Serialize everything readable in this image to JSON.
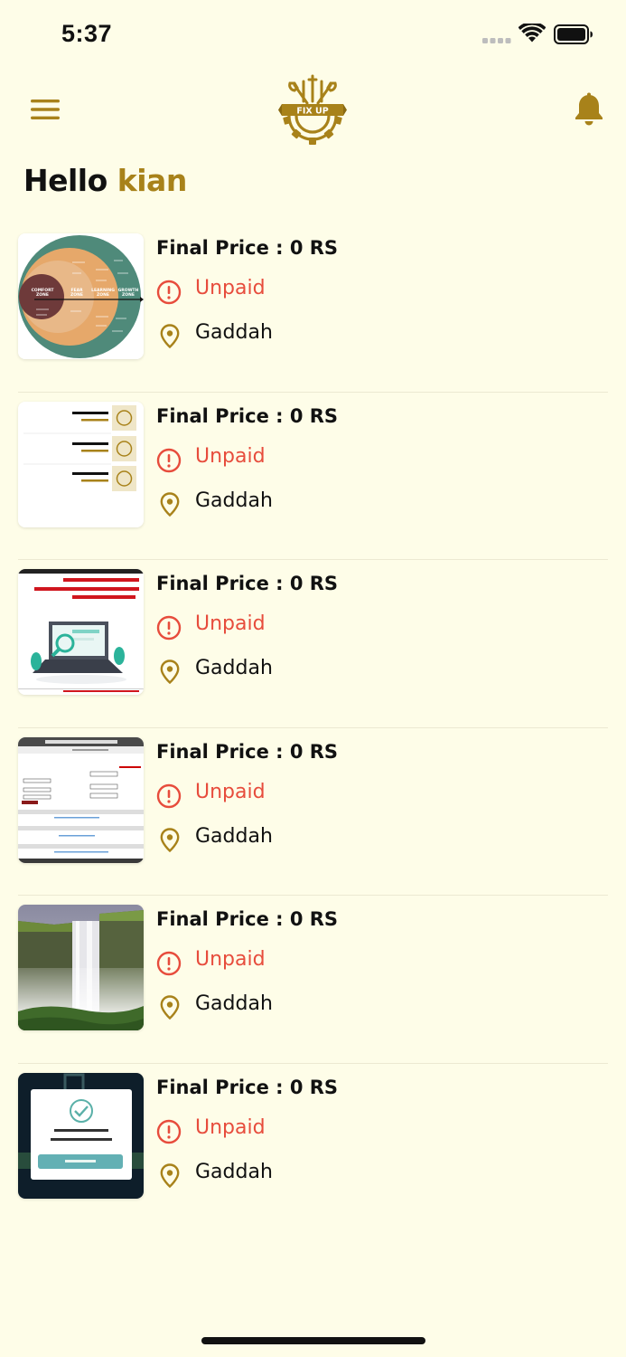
{
  "status_bar": {
    "time": "5:37",
    "icons": [
      "signal-dots-icon",
      "wifi-icon",
      "battery-icon"
    ]
  },
  "header": {
    "menu_icon": "hamburger-menu-icon",
    "logo_text": "FIX UP",
    "bell_icon": "bell-icon"
  },
  "greeting": {
    "prefix": "Hello",
    "name": "kian"
  },
  "colors": {
    "background": "#fefde8",
    "accent": "#a8821a",
    "unpaid": "#e74c3c",
    "text": "#111111"
  },
  "orders": [
    {
      "price_label": "Final Price : 0 RS",
      "status": "Unpaid",
      "city": "Gaddah",
      "thumbnail": "comfort-zone-diagram-image"
    },
    {
      "price_label": "Final Price : 0 RS",
      "status": "Unpaid",
      "city": "Gaddah",
      "thumbnail": "order-list-screenshot-image"
    },
    {
      "price_label": "Final Price : 0 RS",
      "status": "Unpaid",
      "city": "Gaddah",
      "thumbnail": "file-review-illustration-image"
    },
    {
      "price_label": "Final Price : 0 RS",
      "status": "Unpaid",
      "city": "Gaddah",
      "thumbnail": "government-portal-form-image"
    },
    {
      "price_label": "Final Price : 0 RS",
      "status": "Unpaid",
      "city": "Gaddah",
      "thumbnail": "waterfall-photo-image"
    },
    {
      "price_label": "Final Price : 0 RS",
      "status": "Unpaid",
      "city": "Gaddah",
      "thumbnail": "account-verified-dialog-image"
    }
  ]
}
